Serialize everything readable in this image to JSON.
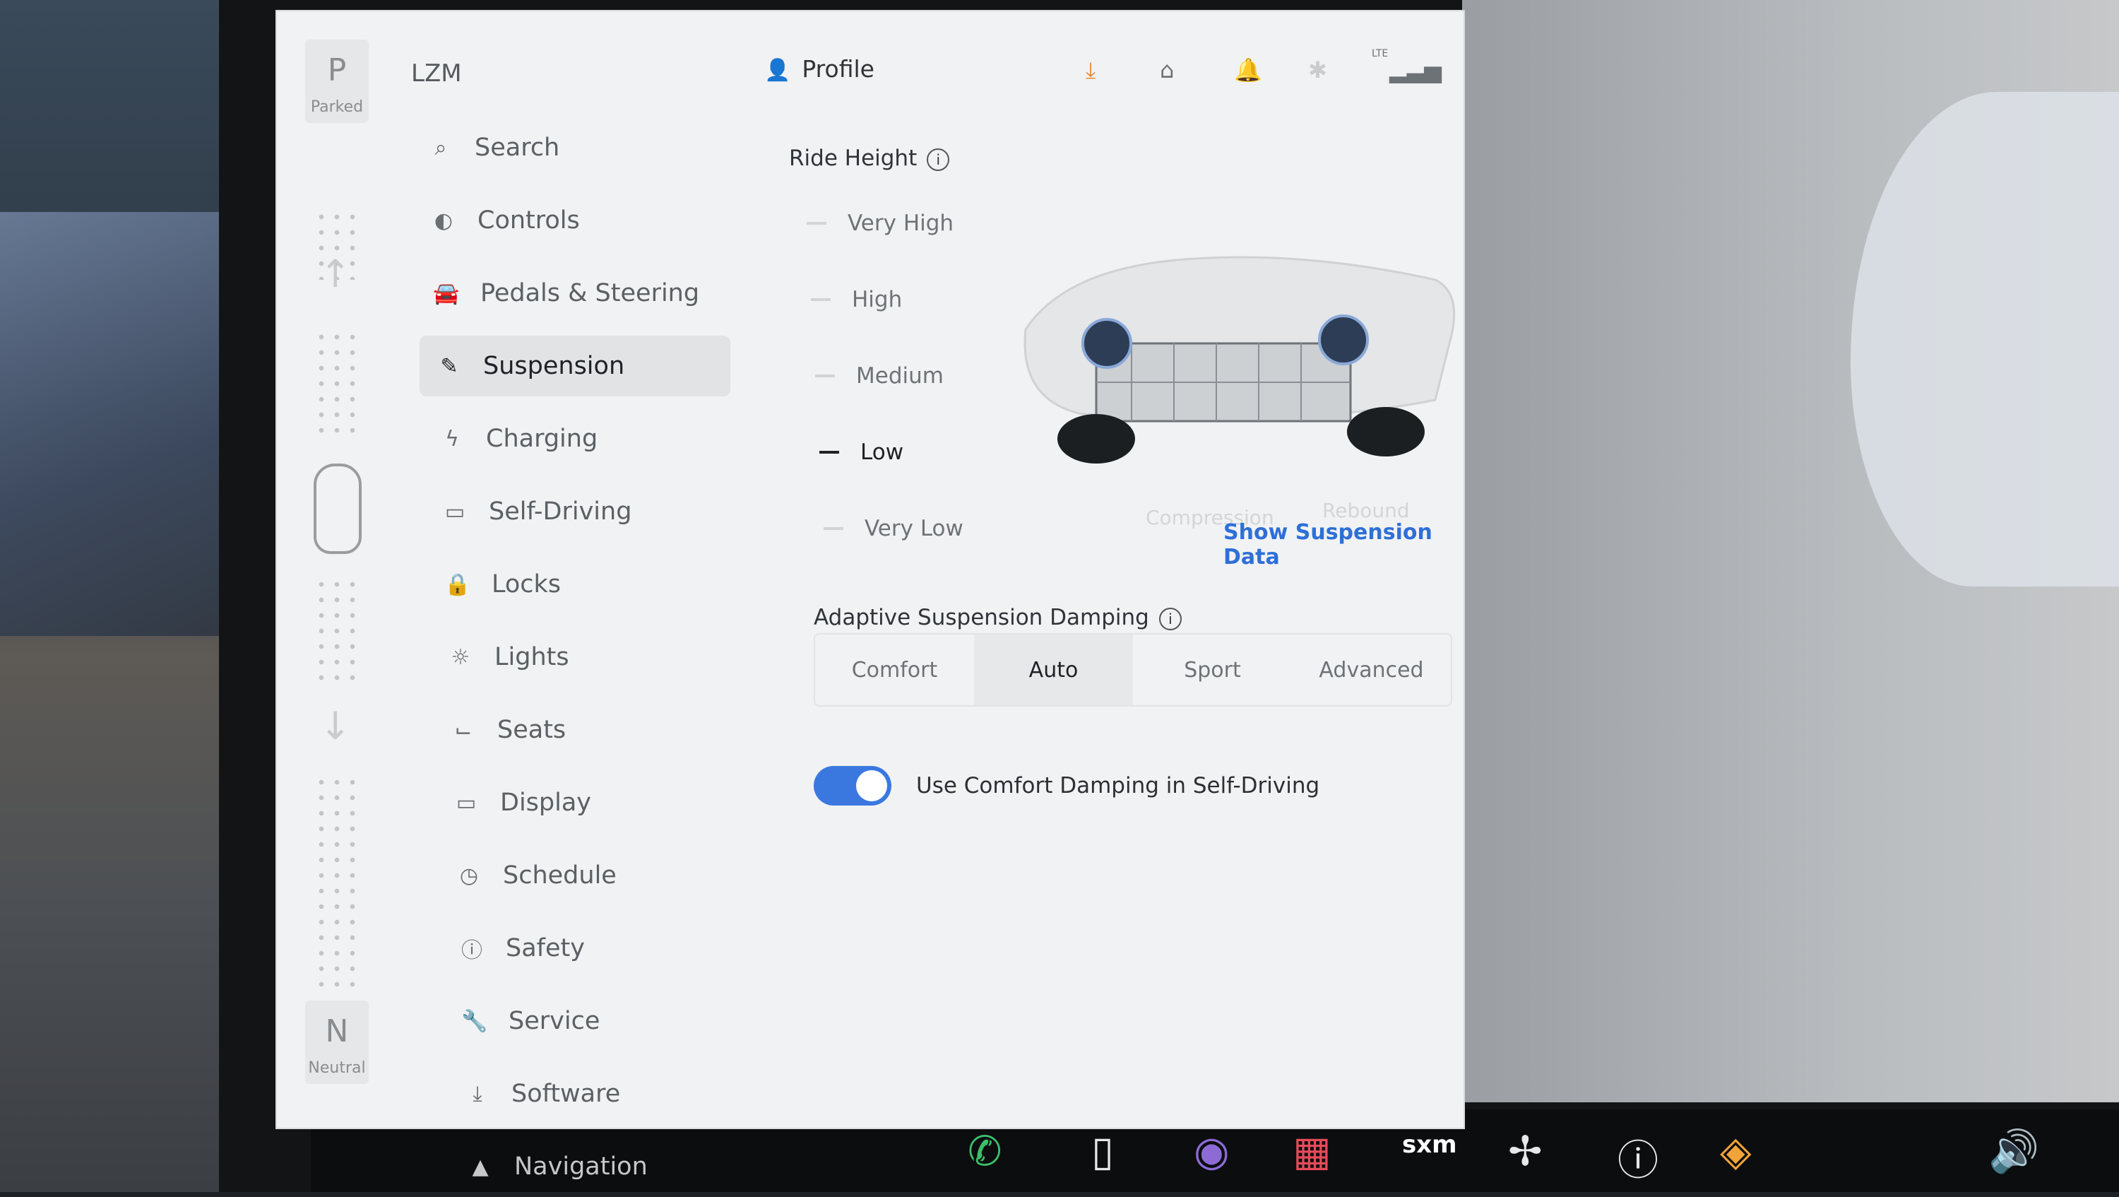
{
  "header": {
    "brand": "LZM",
    "profile_label": "Profile",
    "status_icons": [
      "download-icon",
      "garage-icon",
      "bell-icon",
      "bluetooth-icon",
      "lte-signal-icon"
    ],
    "lte_label": "LTE"
  },
  "gear_rail": {
    "top": {
      "letter": "P",
      "label": "Parked"
    },
    "bottom": {
      "letter": "N",
      "label": "Neutral"
    }
  },
  "nav": {
    "items": [
      {
        "label": "Search",
        "icon": "search-icon"
      },
      {
        "label": "Controls",
        "icon": "toggle-icon"
      },
      {
        "label": "Pedals & Steering",
        "icon": "car-icon"
      },
      {
        "label": "Suspension",
        "icon": "suspension-icon",
        "active": true
      },
      {
        "label": "Charging",
        "icon": "bolt-icon"
      },
      {
        "label": "Self-Driving",
        "icon": "steering-icon"
      },
      {
        "label": "Locks",
        "icon": "lock-icon"
      },
      {
        "label": "Lights",
        "icon": "light-icon"
      },
      {
        "label": "Seats",
        "icon": "seat-icon"
      },
      {
        "label": "Display",
        "icon": "display-icon"
      },
      {
        "label": "Schedule",
        "icon": "clock-icon"
      },
      {
        "label": "Safety",
        "icon": "safety-icon"
      },
      {
        "label": "Service",
        "icon": "wrench-icon"
      },
      {
        "label": "Software",
        "icon": "download-icon"
      },
      {
        "label": "Navigation",
        "icon": "navigation-icon",
        "faded": true
      }
    ]
  },
  "ride_height": {
    "title": "Ride Height",
    "options": [
      "Very High",
      "High",
      "Medium",
      "Low",
      "Very Low"
    ],
    "selected": "Low",
    "compression_label": "Compression",
    "rebound_label": "Rebound",
    "show_data_link": "Show Suspension Data"
  },
  "damping": {
    "title": "Adaptive Suspension Damping",
    "options": [
      "Comfort",
      "Auto",
      "Sport",
      "Advanced"
    ],
    "selected": "Auto"
  },
  "comfort_toggle": {
    "label": "Use Comfort Damping in Self-Driving",
    "on": true
  },
  "dock": {
    "labels": [
      "sxm"
    ]
  },
  "colors": {
    "accent": "#3a78e0",
    "link": "#2e6fd8",
    "download_icon": "#e98a3a"
  }
}
